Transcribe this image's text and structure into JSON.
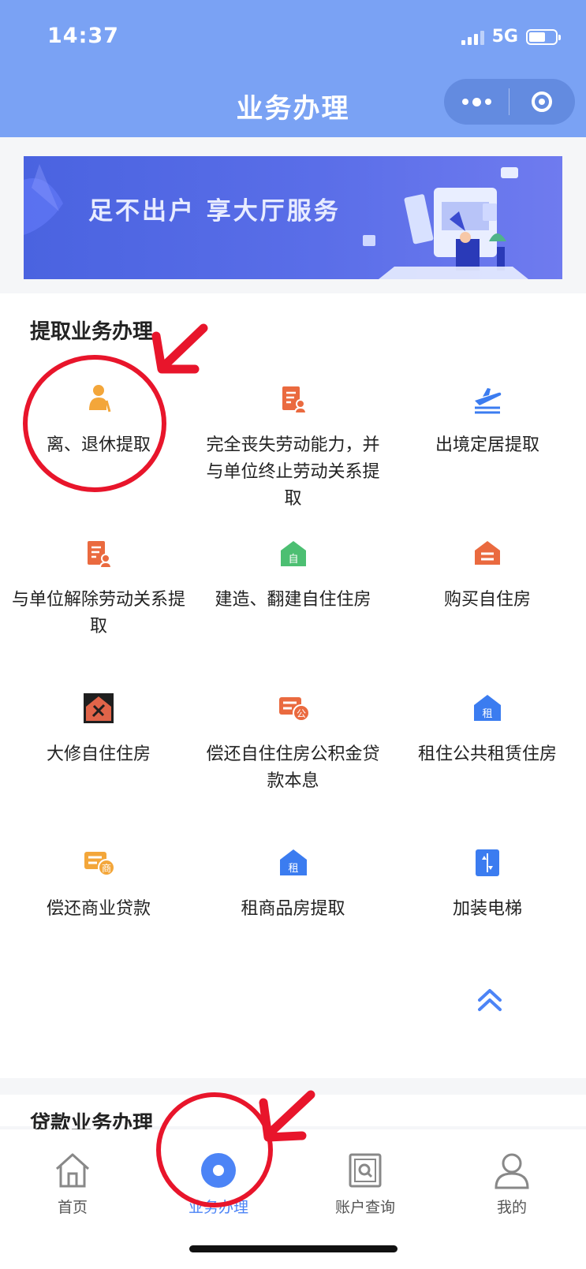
{
  "status_bar": {
    "time": "14:37",
    "network": "5G",
    "battery_level": 0.55
  },
  "nav": {
    "title": "业务办理"
  },
  "banner": {
    "text": "足不出户 享大厅服务"
  },
  "withdraw_section": {
    "title": "提取业务办理",
    "items": [
      {
        "label": "离、退休提取",
        "icon": "retiree-icon",
        "color": "#f3a63a"
      },
      {
        "label": "完全丧失劳动能力，并与单位终止劳动关系提取",
        "icon": "document-person-icon",
        "color": "#ea6a3f"
      },
      {
        "label": "出境定居提取",
        "icon": "airplane-departure-icon",
        "color": "#3b7cf0"
      },
      {
        "label": "与单位解除劳动关系提取",
        "icon": "document-person-icon",
        "color": "#ea6a3f"
      },
      {
        "label": "建造、翻建自住住房",
        "icon": "house-self-icon",
        "color": "#4cbf72"
      },
      {
        "label": "购买自住房",
        "icon": "house-buy-icon",
        "color": "#ea6a3f"
      },
      {
        "label": "大修自住住房",
        "icon": "house-repair-icon",
        "color": "#e06449"
      },
      {
        "label": "偿还自住住房公积金贷款本息",
        "icon": "loan-fund-icon",
        "color": "#ea6a3f"
      },
      {
        "label": "租住公共租赁住房",
        "icon": "house-rent-icon",
        "color": "#3b7cf0"
      },
      {
        "label": "偿还商业贷款",
        "icon": "loan-commercial-icon",
        "color": "#f3a63a"
      },
      {
        "label": "租商品房提取",
        "icon": "house-rent-icon",
        "color": "#3b7cf0"
      },
      {
        "label": "加装电梯",
        "icon": "elevator-icon",
        "color": "#3b7cf0"
      }
    ]
  },
  "loan_section": {
    "title": "贷款业务办理"
  },
  "tabbar": {
    "tabs": [
      {
        "label": "首页",
        "icon": "home-icon",
        "active": false
      },
      {
        "label": "业务办理",
        "icon": "business-icon",
        "active": true
      },
      {
        "label": "账户查询",
        "icon": "account-query-icon",
        "active": false
      },
      {
        "label": "我的",
        "icon": "user-icon",
        "active": false
      }
    ]
  },
  "colors": {
    "header": "#7aa2f4",
    "accent": "#4c84f6",
    "annotation": "#e8152b"
  }
}
